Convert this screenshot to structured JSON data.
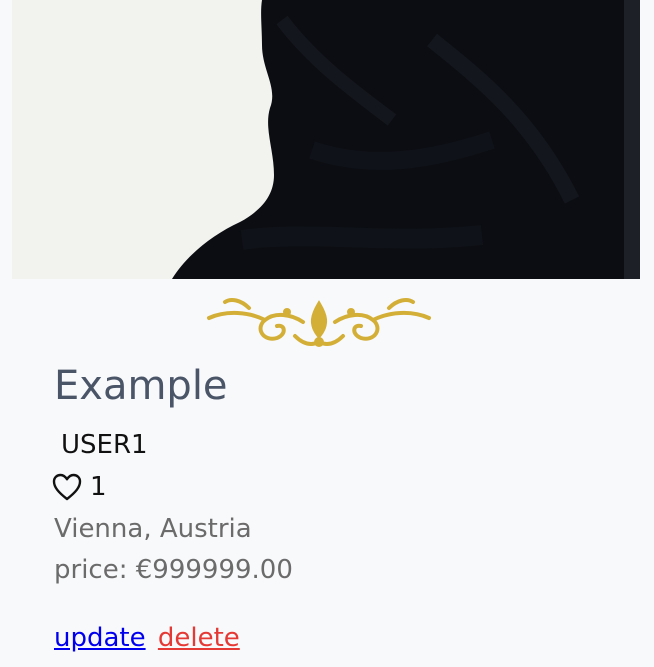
{
  "listing": {
    "title": "Example",
    "username": "USER1",
    "like_count": "1",
    "location": "Vienna, Austria",
    "price": "price: €999999.00"
  },
  "actions": {
    "update_label": "update",
    "delete_label": "delete"
  },
  "icons": {
    "like": "heart-outline-icon",
    "ornament": "flourish-divider-icon"
  },
  "colors": {
    "title": "#4a5568",
    "muted_text": "#6b6b6b",
    "link": "#0000ee",
    "danger_link": "#e53935",
    "ornament_gold": "#d4af37",
    "background": "#f8f9fb"
  }
}
